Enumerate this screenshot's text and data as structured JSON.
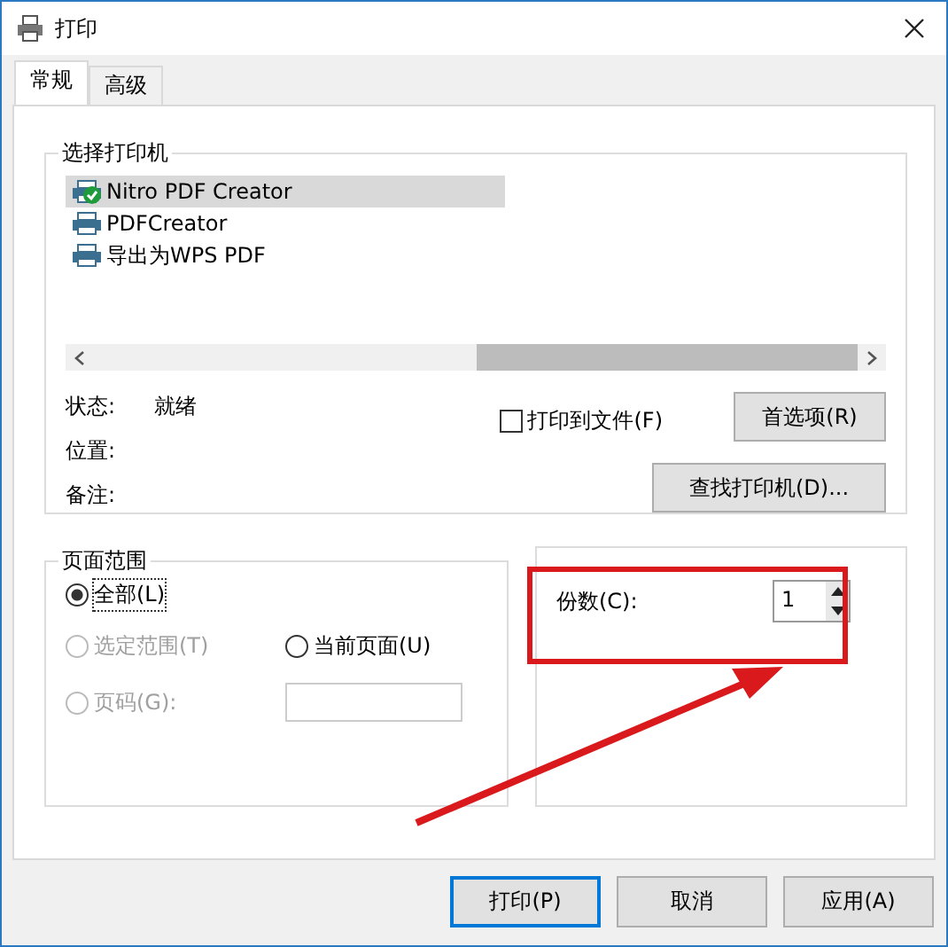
{
  "window": {
    "title": "打印"
  },
  "tabs": [
    {
      "label": "常规",
      "selected": true
    },
    {
      "label": "高级",
      "selected": false
    }
  ],
  "printer_group": {
    "title": "选择打印机",
    "printers": [
      {
        "name": "Nitro PDF Creator",
        "kind": "default",
        "selected": true
      },
      {
        "name": "PDFCreator",
        "kind": "normal",
        "selected": false
      },
      {
        "name": "导出为WPS PDF",
        "kind": "normal",
        "selected": false
      }
    ],
    "info": [
      {
        "label": "状态:",
        "value": "就绪"
      },
      {
        "label": "位置:"
      },
      {
        "label": "备注:"
      }
    ],
    "print_to_file": {
      "label": "打印到文件(F)",
      "checked": false
    },
    "preferences_button": "首选项(R)",
    "find_printer_button": "查找打印机(D)..."
  },
  "page_range": {
    "title": "页面范围",
    "options": [
      {
        "label": "全部(L)",
        "selected": true,
        "disabled": false
      },
      {
        "label": "选定范围(T)",
        "selected": false,
        "disabled": true
      },
      {
        "label": "当前页面(U)",
        "selected": false,
        "disabled": false
      },
      {
        "label": "页码(G):",
        "selected": false,
        "disabled": true
      }
    ]
  },
  "copies": {
    "label": "份数(C):",
    "value": "1"
  },
  "buttons": [
    {
      "label": "打印(P)",
      "default": true
    },
    {
      "label": "取消",
      "default": false
    },
    {
      "label": "应用(A)",
      "default": false
    }
  ]
}
